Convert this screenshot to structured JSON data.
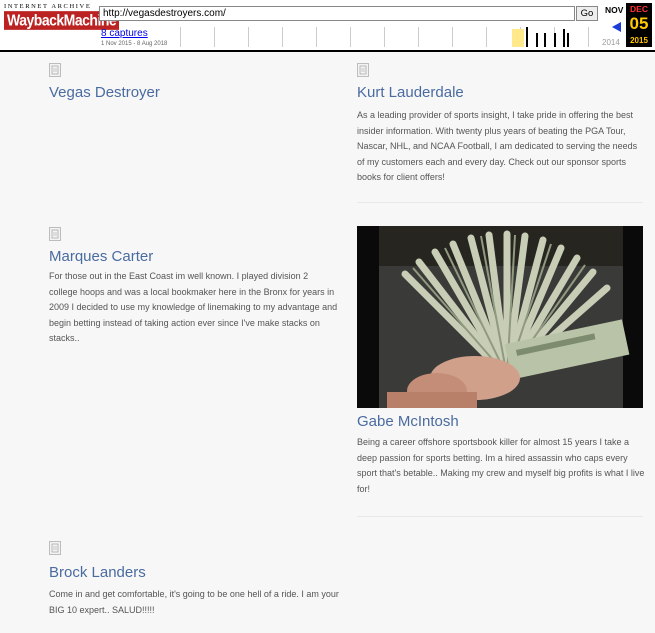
{
  "wayback": {
    "logo_top": "INTERNET ARCHIVE",
    "logo_main": "WaybackMachine",
    "url": "http://vegasdestroyers.com/",
    "go_label": "Go",
    "captures": "8 captures",
    "range": "1 Nov 2015 - 8 Aug 2018",
    "prev_month": "NOV",
    "current_month": "DEC",
    "current_day": "05",
    "prev_year": "2014",
    "current_year": "2015"
  },
  "handicappers": [
    {
      "name": "Vegas Destroyer",
      "bio": ""
    },
    {
      "name": "Kurt Lauderdale",
      "bio": "As a leading provider of sports insight, I take pride in offering the best insider information. With twenty plus years of beating the PGA Tour, Nascar, NHL, and NCAA Football, I am dedicated to serving the needs of my customers each and every day. Check out our sponsor sports books for client offers!"
    },
    {
      "name": "Marques Carter",
      "bio": "For those out in the East Coast im well known. I played division 2 college hoops and was a local bookmaker here in the Bronx for years in 2009 I decided to use my knowledge of linemaking to my advantage and begin betting instead of taking action ever since I've make stacks on stacks.."
    },
    {
      "name": "Gabe McIntosh",
      "bio": "Being a career offshore sportsbook killer for almost 15 years I take a deep passion for sports betting. Im a hired assassin who caps every sport that's betable.. Making my crew and myself big profits is what I live for!"
    },
    {
      "name": "Brock Landers",
      "bio": "Come in and get comfortable, it's going to be one hell of a ride. I am your BIG 10 expert.. SALUD!!!!!"
    }
  ]
}
